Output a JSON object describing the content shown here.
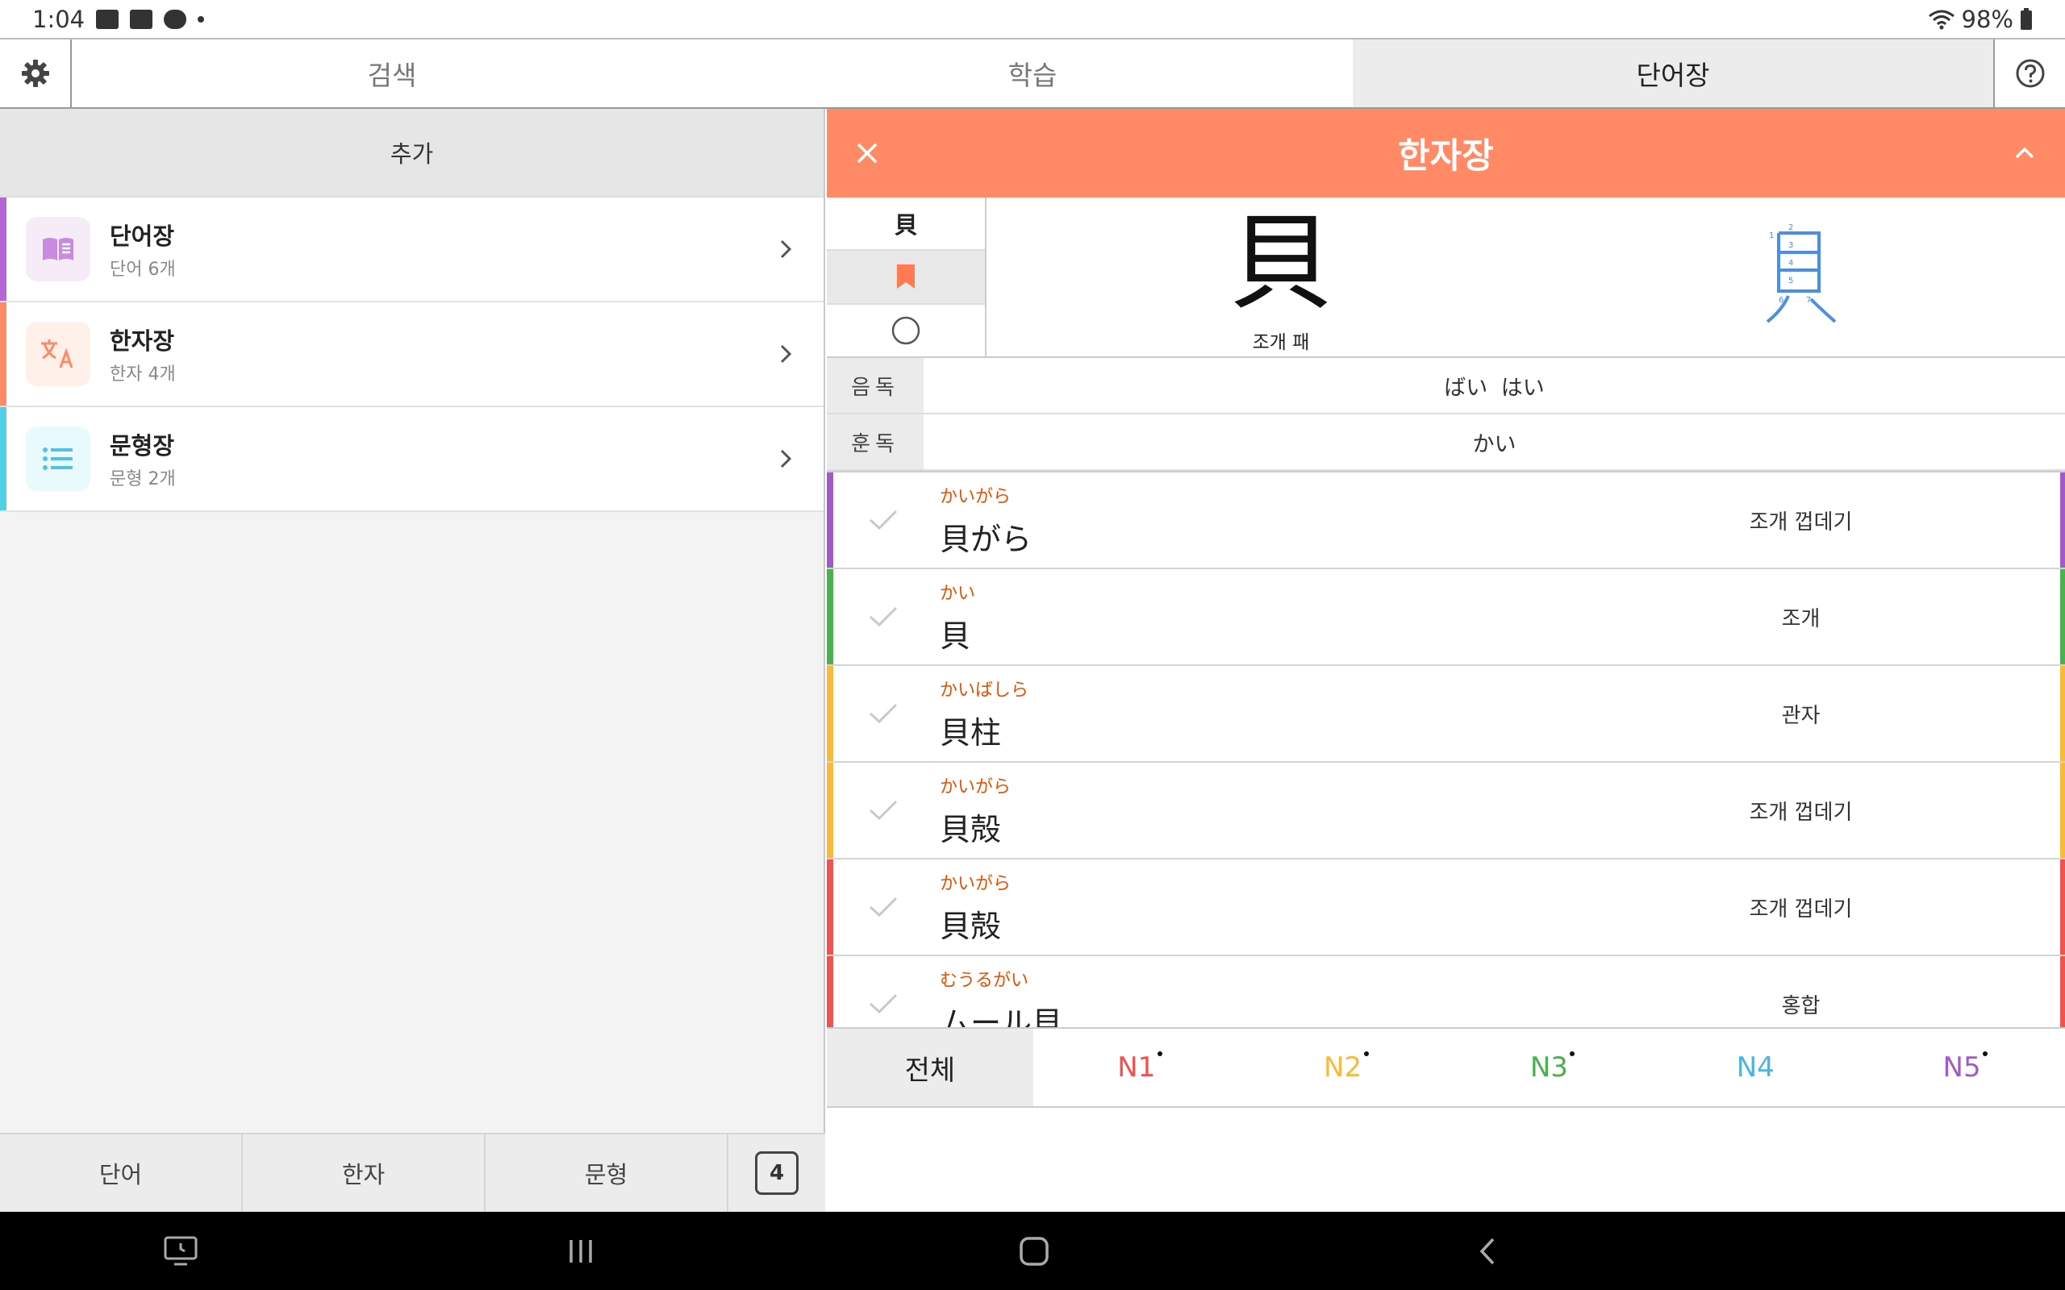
{
  "status_bar": {
    "time": "1:04",
    "battery": "98%"
  },
  "top_tabs": [
    {
      "label": "검색"
    },
    {
      "label": "학습"
    },
    {
      "label": "단어장"
    }
  ],
  "left": {
    "add_label": "추가",
    "books": [
      {
        "title": "단어장",
        "subtitle": "단어 6개",
        "color": "#b565d6",
        "icon_bg": "#f6ecf8"
      },
      {
        "title": "한자장",
        "subtitle": "한자 4개",
        "color": "#ff8a65",
        "icon_bg": "#fff0ea"
      },
      {
        "title": "문형장",
        "subtitle": "문형 2개",
        "color": "#4fd0e6",
        "icon_bg": "#e9fafc"
      }
    ],
    "bottom_tabs": [
      "단어",
      "한자",
      "문형"
    ],
    "count": "4"
  },
  "detail": {
    "title": "한자장",
    "kanji": "貝",
    "meaning": "조개 패",
    "on_label": "음독",
    "on_reading": "ばい はい",
    "kun_label": "훈독",
    "kun_reading": "かい",
    "vocab": [
      {
        "furigana": "かいがら",
        "word": "貝がら",
        "meaning": "조개 껍데기",
        "color": "#a05bc9"
      },
      {
        "furigana": "かい",
        "word": "貝",
        "meaning": "조개",
        "color": "#4caf50"
      },
      {
        "furigana": "かいばしら",
        "word": "貝柱",
        "meaning": "관자",
        "color": "#f9b93a"
      },
      {
        "furigana": "かいがら",
        "word": "貝殻",
        "meaning": "조개 껍데기",
        "color": "#f9b93a"
      },
      {
        "furigana": "かいがら",
        "word": "貝殻",
        "meaning": "조개 껍데기",
        "color": "#ef5350"
      },
      {
        "furigana": "むうるがい",
        "word": "ムール貝",
        "meaning": "홍합",
        "color": "#ef5350"
      }
    ],
    "levels": [
      {
        "label": "전체",
        "color": "#222222"
      },
      {
        "label": "N1",
        "color": "#ef5350"
      },
      {
        "label": "N2",
        "color": "#f9b93a"
      },
      {
        "label": "N3",
        "color": "#4caf50"
      },
      {
        "label": "N4",
        "color": "#4fb3e0"
      },
      {
        "label": "N5",
        "color": "#a05bc9"
      }
    ]
  }
}
